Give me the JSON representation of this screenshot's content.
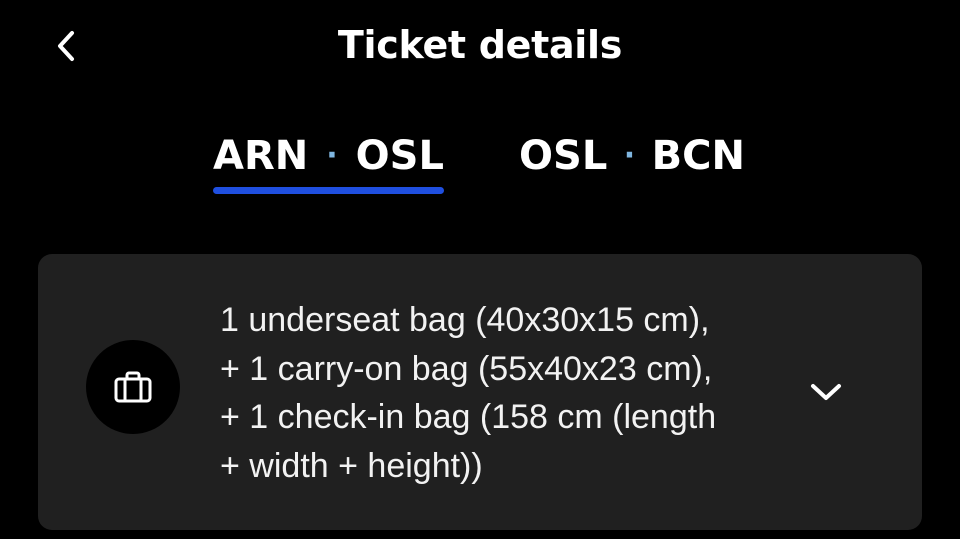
{
  "header": {
    "title": "Ticket details",
    "back_icon": "chevron-left-icon"
  },
  "tabs": [
    {
      "from": "ARN",
      "separator": "·",
      "to": "OSL",
      "active": true
    },
    {
      "from": "OSL",
      "separator": "·",
      "to": "BCN",
      "active": false
    }
  ],
  "colors": {
    "background": "#000000",
    "card_background": "#202020",
    "accent_underline": "#1f4fe0",
    "separator_dot": "#7fb6e0",
    "text": "#ffffff"
  },
  "baggage": {
    "icon": "suitcase-icon",
    "lines": [
      "1 underseat bag (40x30x15 cm),",
      "+ 1 carry-on bag (55x40x23 cm),",
      "+ 1 check-in bag (158 cm (length",
      "+ width + height))"
    ],
    "expand_icon": "chevron-down-icon"
  }
}
